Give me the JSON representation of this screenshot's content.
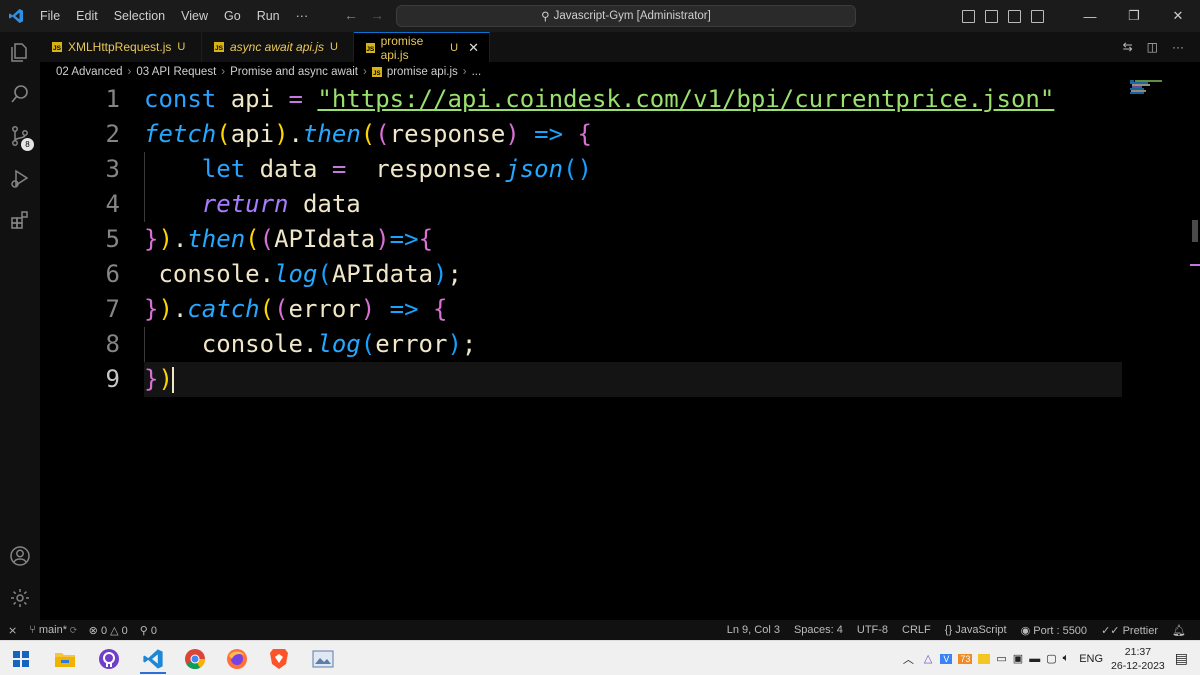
{
  "menu": [
    "File",
    "Edit",
    "Selection",
    "View",
    "Go",
    "Run",
    "···"
  ],
  "title": "Javascript-Gym [Administrator]",
  "tabs": [
    {
      "label": "XMLHttpRequest.js",
      "status": "U",
      "italic": false,
      "active": false
    },
    {
      "label": "async await api.js",
      "status": "U",
      "italic": true,
      "active": false
    },
    {
      "label": "promise api.js",
      "status": "U",
      "italic": false,
      "active": true
    }
  ],
  "js_badge": "JS",
  "breadcrumb": [
    "02 Advanced",
    "03 API Request",
    "Promise and async await",
    "promise api.js",
    "..."
  ],
  "scm_badge": "8",
  "code": {
    "line_numbers": [
      "1",
      "2",
      "3",
      "4",
      "5",
      "6",
      "7",
      "8",
      "9"
    ],
    "lines": [
      [
        {
          "t": "const",
          "c": "kw"
        },
        {
          "t": " api ",
          "c": "id"
        },
        {
          "t": "=",
          "c": "op"
        },
        {
          "t": " ",
          "c": "id"
        },
        {
          "t": "\"https://api.coindesk.com/v1/bpi/currentprice.json\"",
          "c": "str"
        }
      ],
      [
        {
          "t": "fetch",
          "c": "fn"
        },
        {
          "t": "(",
          "c": "p1"
        },
        {
          "t": "api",
          "c": "id"
        },
        {
          "t": ")",
          "c": "p1"
        },
        {
          "t": ".",
          "c": "id"
        },
        {
          "t": "then",
          "c": "fn"
        },
        {
          "t": "(",
          "c": "p1"
        },
        {
          "t": "(",
          "c": "p2"
        },
        {
          "t": "response",
          "c": "id"
        },
        {
          "t": ")",
          "c": "p2"
        },
        {
          "t": " ",
          "c": "id"
        },
        {
          "t": "=>",
          "c": "arrow"
        },
        {
          "t": " ",
          "c": "id"
        },
        {
          "t": "{",
          "c": "p2"
        }
      ],
      [
        {
          "t": "    ",
          "c": "id"
        },
        {
          "t": "let",
          "c": "kw"
        },
        {
          "t": " data ",
          "c": "id"
        },
        {
          "t": "=",
          "c": "op"
        },
        {
          "t": "  response.",
          "c": "id"
        },
        {
          "t": "json",
          "c": "fn"
        },
        {
          "t": "()",
          "c": "p3"
        }
      ],
      [
        {
          "t": "    ",
          "c": "id"
        },
        {
          "t": "return",
          "c": "ret"
        },
        {
          "t": " data",
          "c": "id"
        }
      ],
      [
        {
          "t": "}",
          "c": "p2"
        },
        {
          "t": ")",
          "c": "p1"
        },
        {
          "t": ".",
          "c": "id"
        },
        {
          "t": "then",
          "c": "fn"
        },
        {
          "t": "(",
          "c": "p1"
        },
        {
          "t": "(",
          "c": "p2"
        },
        {
          "t": "APIdata",
          "c": "id"
        },
        {
          "t": ")",
          "c": "p2"
        },
        {
          "t": "=>",
          "c": "arrow"
        },
        {
          "t": "{",
          "c": "p2"
        }
      ],
      [
        {
          "t": " console.",
          "c": "id"
        },
        {
          "t": "log",
          "c": "fn"
        },
        {
          "t": "(",
          "c": "p3"
        },
        {
          "t": "APIdata",
          "c": "id"
        },
        {
          "t": ")",
          "c": "p3"
        },
        {
          "t": ";",
          "c": "id"
        }
      ],
      [
        {
          "t": "}",
          "c": "p2"
        },
        {
          "t": ")",
          "c": "p1"
        },
        {
          "t": ".",
          "c": "id"
        },
        {
          "t": "catch",
          "c": "fn"
        },
        {
          "t": "(",
          "c": "p1"
        },
        {
          "t": "(",
          "c": "p2"
        },
        {
          "t": "error",
          "c": "id"
        },
        {
          "t": ")",
          "c": "p2"
        },
        {
          "t": " ",
          "c": "id"
        },
        {
          "t": "=>",
          "c": "arrow"
        },
        {
          "t": " ",
          "c": "id"
        },
        {
          "t": "{",
          "c": "p2"
        }
      ],
      [
        {
          "t": "    console.",
          "c": "id"
        },
        {
          "t": "log",
          "c": "fn"
        },
        {
          "t": "(",
          "c": "p3"
        },
        {
          "t": "error",
          "c": "id"
        },
        {
          "t": ")",
          "c": "p3"
        },
        {
          "t": ";",
          "c": "id"
        }
      ],
      [
        {
          "t": "}",
          "c": "p2"
        },
        {
          "t": ")",
          "c": "p1"
        }
      ]
    ],
    "current_line": 9
  },
  "status": {
    "branch": "main*",
    "errors": "0",
    "warnings": "0",
    "ports": "0",
    "cursor": "Ln 9, Col 3",
    "spaces": "Spaces: 4",
    "encoding": "UTF-8",
    "eol": "CRLF",
    "language": "JavaScript",
    "port": "Port : 5500",
    "prettier": "Prettier"
  },
  "tray": {
    "lang": "ENG",
    "time": "21:37",
    "date": "26-12-2023",
    "temp_badge": "73"
  },
  "colors": {
    "accent": "#0a74d0",
    "tab_label": "#e8c85a",
    "keyword": "#2aa2ff",
    "string": "#9ae06e"
  }
}
